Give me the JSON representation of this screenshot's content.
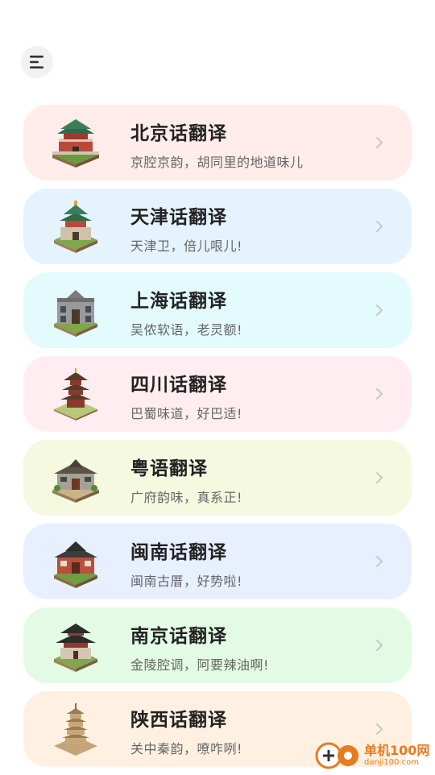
{
  "header": {
    "menu_icon": "menu-icon"
  },
  "items": [
    {
      "title": "北京话翻译",
      "subtitle": "京腔京韵，胡同里的地道味儿",
      "bg": "#ffeceb",
      "icon": "beijing-gate-icon"
    },
    {
      "title": "天津话翻译",
      "subtitle": "天津卫，倍儿哏儿!",
      "bg": "#e5f3fe",
      "icon": "tianjin-tower-icon"
    },
    {
      "title": "上海话翻译",
      "subtitle": "吴侬软语，老灵额!",
      "bg": "#e3fbfd",
      "icon": "shanghai-house-icon"
    },
    {
      "title": "四川话翻译",
      "subtitle": "巴蜀味道，好巴适!",
      "bg": "#ffedf1",
      "icon": "sichuan-pagoda-icon"
    },
    {
      "title": "粤语翻译",
      "subtitle": "广府韵味，真系正!",
      "bg": "#f4f9df",
      "icon": "guangdong-house-icon"
    },
    {
      "title": "闽南话翻译",
      "subtitle": "闽南古厝，好势啦!",
      "bg": "#e8efff",
      "icon": "minnan-house-icon"
    },
    {
      "title": "南京话翻译",
      "subtitle": "金陵腔调，阿要辣油啊!",
      "bg": "#e3fbe4",
      "icon": "nanjing-tower-icon"
    },
    {
      "title": "陕西话翻译",
      "subtitle": "关中秦韵，嘹咋咧!",
      "bg": "#fff0e2",
      "icon": "shaanxi-pagoda-icon"
    }
  ],
  "watermark": {
    "main": "单机100网",
    "sub": "danji100.com"
  }
}
